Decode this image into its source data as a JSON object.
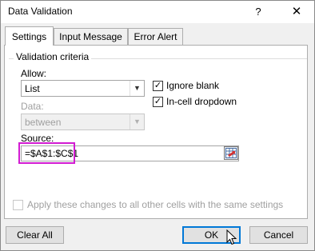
{
  "window": {
    "title": "Data Validation",
    "help": "?",
    "close": "✕"
  },
  "tabs": [
    {
      "label": "Settings",
      "active": true
    },
    {
      "label": "Input Message",
      "active": false
    },
    {
      "label": "Error Alert",
      "active": false
    }
  ],
  "validation": {
    "group_label": "Validation criteria",
    "allow_label": "Allow:",
    "allow_value": "List",
    "data_label": "Data:",
    "data_value": "between",
    "ignore_blank_label": "Ignore blank",
    "ignore_blank_checked": true,
    "dropdown_label": "In-cell dropdown",
    "dropdown_checked": true,
    "source_label": "Source:",
    "source_value": "=$A$1:$C$1"
  },
  "apply_all": {
    "label": "Apply these changes to all other cells with the same settings",
    "checked": false
  },
  "buttons": {
    "clear_all": "Clear All",
    "ok": "OK",
    "cancel": "Cancel"
  },
  "colors": {
    "highlight": "#d21bd2",
    "default_button_border": "#0078d7"
  }
}
